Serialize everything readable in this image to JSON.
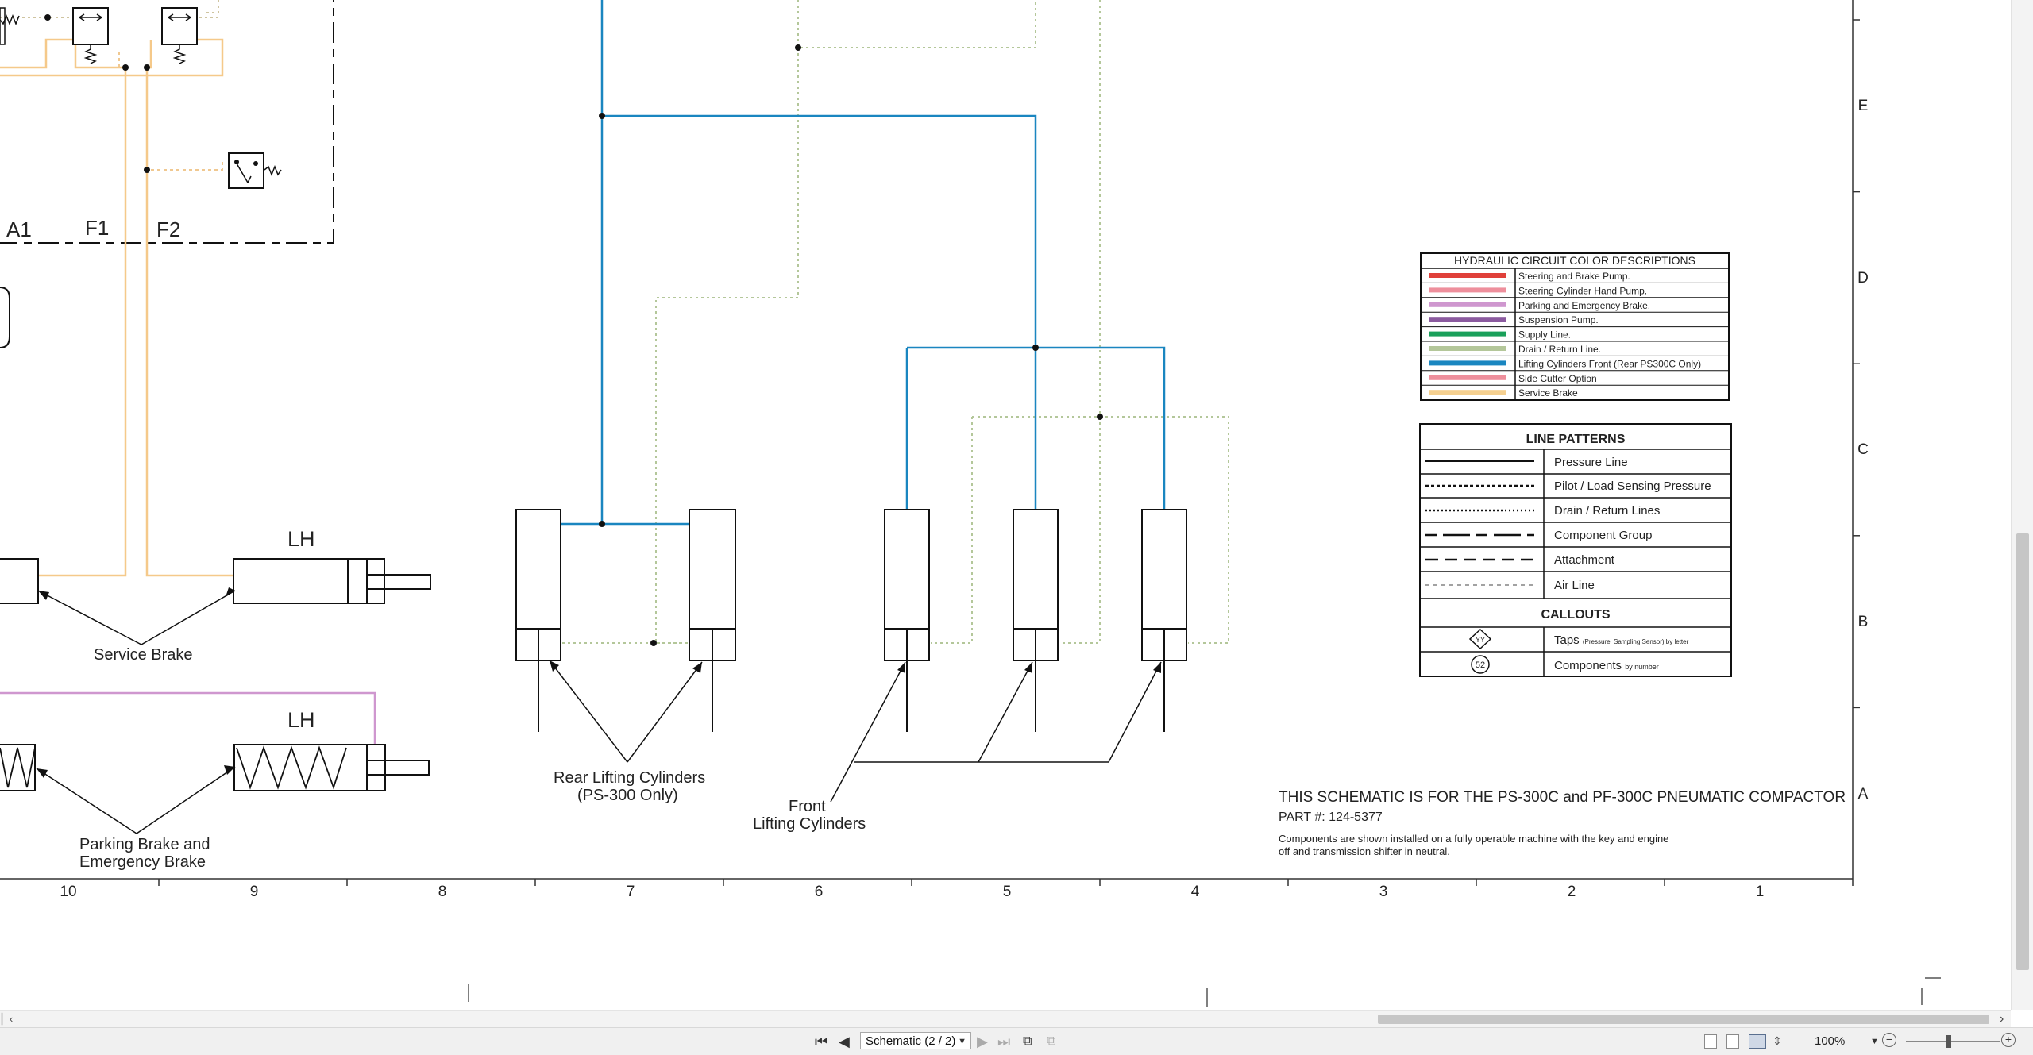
{
  "legend": {
    "title": "HYDRAULIC CIRCUIT COLOR DESCRIPTIONS",
    "items": [
      {
        "label": "Steering and Brake Pump.",
        "color": "#e0403a"
      },
      {
        "label": "Steering Cylinder Hand Pump.",
        "color": "#ee8f9c"
      },
      {
        "label": "Parking and Emergency Brake.",
        "color": "#cf97cf"
      },
      {
        "label": "Suspension Pump.",
        "color": "#8b5a9f"
      },
      {
        "label": "Supply Line.",
        "color": "#1aa05a"
      },
      {
        "label": "Drain / Return Line.",
        "color": "#b4c79a"
      },
      {
        "label": "Lifting Cylinders Front (Rear PS300C Only)",
        "color": "#1a86c0"
      },
      {
        "label": "Side Cutter Option",
        "color": "#ee8f9c"
      },
      {
        "label": "Service Brake",
        "color": "#f5d090"
      }
    ]
  },
  "line_patterns": {
    "title": "LINE PATTERNS",
    "items": [
      {
        "label": "Pressure Line"
      },
      {
        "label": "Pilot / Load Sensing Pressure"
      },
      {
        "label": "Drain / Return Lines"
      },
      {
        "label": "Component Group"
      },
      {
        "label": "Attachment"
      },
      {
        "label": "Air Line"
      }
    ],
    "callouts_title": "CALLOUTS",
    "taps_label": "Taps",
    "taps_note": "(Pressure, Sampling,Sensor) by letter",
    "taps_symbol": "YY",
    "components_label": "Components",
    "components_note": "by number",
    "components_symbol": "52"
  },
  "notes": {
    "title": "THIS SCHEMATIC IS FOR THE PS-300C and PF-300C PNEUMATIC COMPACTOR",
    "part": "PART #: 124-5377",
    "desc1": "Components are shown installed on a fully operable machine with the key and engine",
    "desc2": "off and transmission shifter in neutral."
  },
  "labels": {
    "port_a1": "A1",
    "port_f1": "F1",
    "port_f2": "F2",
    "lh_upper": "LH",
    "lh_lower": "LH",
    "service_brake": "Service Brake",
    "parking_brake_1": "Parking Brake and",
    "parking_brake_2": "Emergency Brake",
    "rear_cyl_1": "Rear Lifting Cylinders",
    "rear_cyl_2": "(PS-300 Only)",
    "front_cyl_1": "Front",
    "front_cyl_2": "Lifting Cylinders"
  },
  "grid": {
    "columns": [
      "10",
      "9",
      "8",
      "7",
      "6",
      "5",
      "4",
      "3",
      "2",
      "1"
    ],
    "rows": [
      "E",
      "D",
      "C",
      "B",
      "A"
    ]
  },
  "statusbar": {
    "sheet": "Schematic (2 / 2)",
    "zoom": "100%"
  }
}
